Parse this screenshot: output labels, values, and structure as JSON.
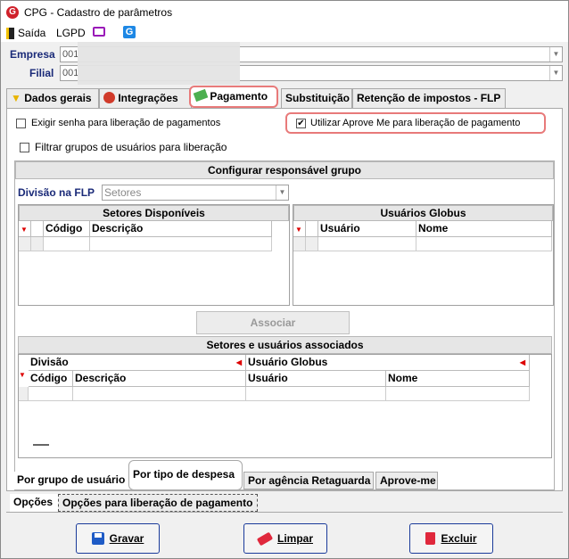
{
  "window": {
    "title": "CPG - Cadastro de parâmetros",
    "logo_letter": "G"
  },
  "menu": {
    "exit_label": "Saída",
    "lgpd_label": "LGPD",
    "globus_letter": "G"
  },
  "header": {
    "empresa_label": "Empresa",
    "empresa_value": "001",
    "filial_label": "Filial",
    "filial_value": "001"
  },
  "tabs": [
    {
      "label": "Dados gerais"
    },
    {
      "label": "Integrações"
    },
    {
      "label": "Pagamento"
    },
    {
      "label": "Substituição"
    },
    {
      "label": "Retenção de impostos - FLP"
    }
  ],
  "pagamento": {
    "exigir_senha_label": "Exigir senha para liberação de pagamentos",
    "exigir_senha_checked": false,
    "aprove_me_label": "Utilizar Aprove Me para liberação de pagamento",
    "aprove_me_checked": true,
    "filtrar_grupos_label": "Filtrar grupos de usuários para liberação",
    "filtrar_grupos_checked": false,
    "configurar_title": "Configurar responsável grupo",
    "divisao_label": "Divisão na FLP",
    "divisao_value": "Setores",
    "setores_title": "Setores Disponíveis",
    "setores_columns": [
      "Código",
      "Descrição"
    ],
    "usuarios_title": "Usuários Globus",
    "usuarios_columns": [
      "Usuário",
      "Nome"
    ],
    "associar_label": "Associar",
    "associados_title": "Setores e usuários associados",
    "assoc_group_headers": [
      "Divisão",
      "Usuário Globus"
    ],
    "assoc_columns": [
      "Código",
      "Descrição",
      "Usuário",
      "Nome"
    ]
  },
  "bottom_tabs": [
    {
      "label": "Por grupo de usuário"
    },
    {
      "label": "Por tipo de despesa"
    },
    {
      "label": "Por agência Retaguarda"
    },
    {
      "label": "Aprove-me"
    }
  ],
  "section_tabs": [
    {
      "label": "Opções"
    },
    {
      "label": "Opções para liberação de pagamento"
    }
  ],
  "footer": {
    "save_label": "Gravar",
    "clear_label": "Limpar",
    "delete_label": "Excluir"
  }
}
